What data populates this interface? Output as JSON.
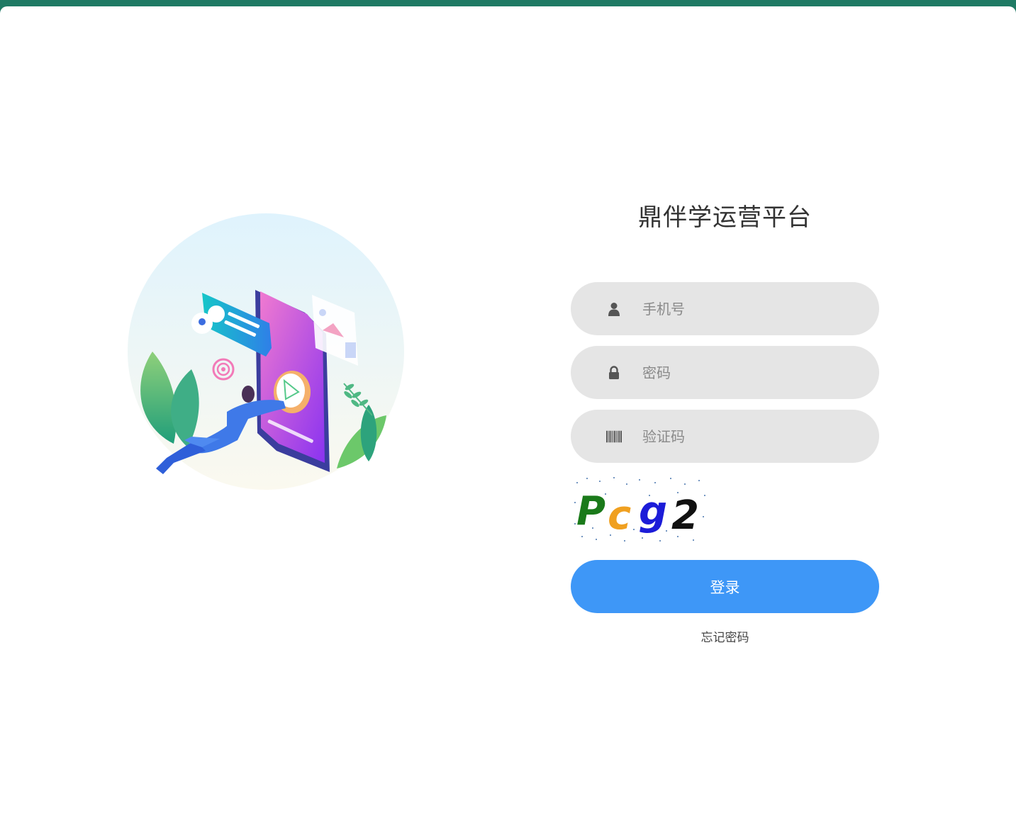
{
  "app": {
    "title": "鼎伴学运营平台"
  },
  "form": {
    "phone_placeholder": "手机号",
    "password_placeholder": "密码",
    "captcha_placeholder": "验证码",
    "captcha_text": "Pcg2",
    "login_label": "登录",
    "forgot_label": "忘记密码"
  },
  "icons": {
    "phone": "user-icon",
    "password": "lock-icon",
    "captcha": "barcode-icon"
  },
  "colors": {
    "top_bar": "#1f7a64",
    "field_bg": "#e5e5e5",
    "primary": "#3e97f7",
    "captcha_chars": [
      "#1a7a1a",
      "#f0a020",
      "#1c1cd8",
      "#111111"
    ]
  }
}
